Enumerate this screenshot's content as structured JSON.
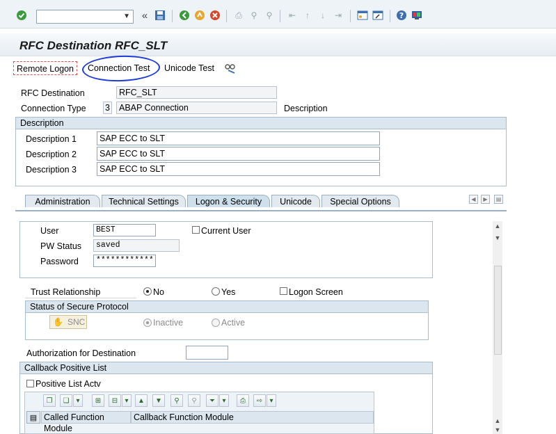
{
  "window": {
    "title": "RFC Destination RFC_SLT"
  },
  "toolbar": {
    "command_value": "",
    "icons": [
      "enter-icon",
      "back-nav-icon",
      "save-icon",
      "back-icon",
      "exit-icon",
      "cancel-icon",
      "print-icon",
      "find-icon",
      "find-next-icon",
      "first-page-icon",
      "previous-page-icon",
      "next-page-icon",
      "last-page-icon",
      "new-session-icon",
      "shortcut-icon",
      "help-icon",
      "customize-layout-icon"
    ]
  },
  "app_toolbar": {
    "remote_logon": "Remote Logon",
    "connection_test": "Connection Test",
    "unicode_test": "Unicode Test"
  },
  "header": {
    "rfc_destination_label": "RFC Destination",
    "rfc_destination_value": "RFC_SLT",
    "connection_type_label": "Connection Type",
    "connection_type_code": "3",
    "connection_type_value": "ABAP Connection",
    "description_link": "Description"
  },
  "description_group": {
    "title": "Description",
    "rows": [
      {
        "label": "Description 1",
        "value": "SAP ECC to SLT"
      },
      {
        "label": "Description 2",
        "value": "SAP ECC to SLT"
      },
      {
        "label": "Description 3",
        "value": "SAP ECC to SLT"
      }
    ]
  },
  "tabs": [
    {
      "label": "Administration",
      "active": false
    },
    {
      "label": "Technical Settings",
      "active": false
    },
    {
      "label": "Logon & Security",
      "active": true
    },
    {
      "label": "Unicode",
      "active": false
    },
    {
      "label": "Special Options",
      "active": false
    }
  ],
  "logon": {
    "user_label": "User",
    "user_value": "BEST",
    "current_user_label": "Current User",
    "pw_status_label": "PW Status",
    "pw_status_value": "saved",
    "password_label": "Password",
    "password_value": "************"
  },
  "trust": {
    "label": "Trust Relationship",
    "no": "No",
    "yes": "Yes",
    "logon_screen": "Logon Screen"
  },
  "secure_protocol": {
    "title": "Status of Secure Protocol",
    "snc_button": "SNC",
    "inactive": "Inactive",
    "active": "Active"
  },
  "authorization": {
    "label": "Authorization for Destination",
    "value": ""
  },
  "callback": {
    "title": "Callback Positive List",
    "positive_list_label": "Positive List Actv",
    "columns": [
      "Called Function Module",
      "Callback Function Module"
    ]
  },
  "colors": {
    "accent_circle": "#1d3bd6",
    "group_header": "#dce6ee",
    "toolbar_bg": "#eef3f8"
  }
}
